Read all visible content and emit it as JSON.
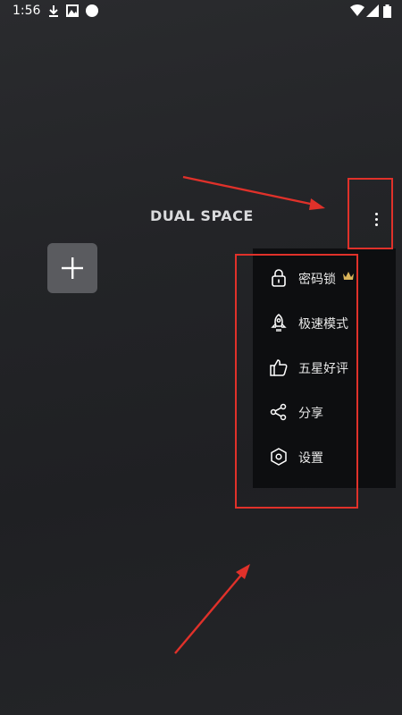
{
  "status_bar": {
    "time": "1:56",
    "icons": [
      "download-icon",
      "photo-icon",
      "circle-icon",
      "wifi-icon",
      "signal-icon",
      "battery-icon"
    ]
  },
  "app": {
    "title": "DUAL SPACE",
    "menu_icon": "more-vertical-icon",
    "add_icon": "plus-icon"
  },
  "menu": {
    "items": [
      {
        "label": "密码锁",
        "icon": "lock-icon",
        "badge_icon": "crown-icon"
      },
      {
        "label": "极速模式",
        "icon": "rocket-icon"
      },
      {
        "label": "五星好评",
        "icon": "thumbs-up-icon"
      },
      {
        "label": "分享",
        "icon": "share-icon"
      },
      {
        "label": "设置",
        "icon": "settings-icon"
      }
    ]
  },
  "colors": {
    "background": "#232427",
    "menu_background": "#0d0e10",
    "annotation": "#e0312a",
    "crown": "#d9b45a"
  }
}
